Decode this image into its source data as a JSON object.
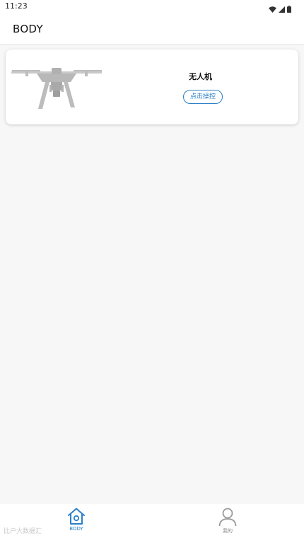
{
  "status_bar": {
    "time": "11:23",
    "icons": [
      "wifi-icon",
      "signal-icon",
      "battery-icon"
    ]
  },
  "app_bar": {
    "title": "BODY"
  },
  "device_card": {
    "name": "无人机",
    "button_label": "点击操控",
    "image_icon": "drone-icon"
  },
  "bottom_nav": {
    "items": [
      {
        "label": "BODY",
        "icon": "home-icon",
        "active": true
      },
      {
        "label": "我的",
        "icon": "user-icon",
        "active": false
      }
    ]
  },
  "watermark": {
    "text": "比户大数据汇"
  },
  "colors": {
    "accent": "#2a7fc6",
    "background": "#f6f7f6",
    "card": "#ffffff",
    "inactive": "#8a8a8a"
  }
}
